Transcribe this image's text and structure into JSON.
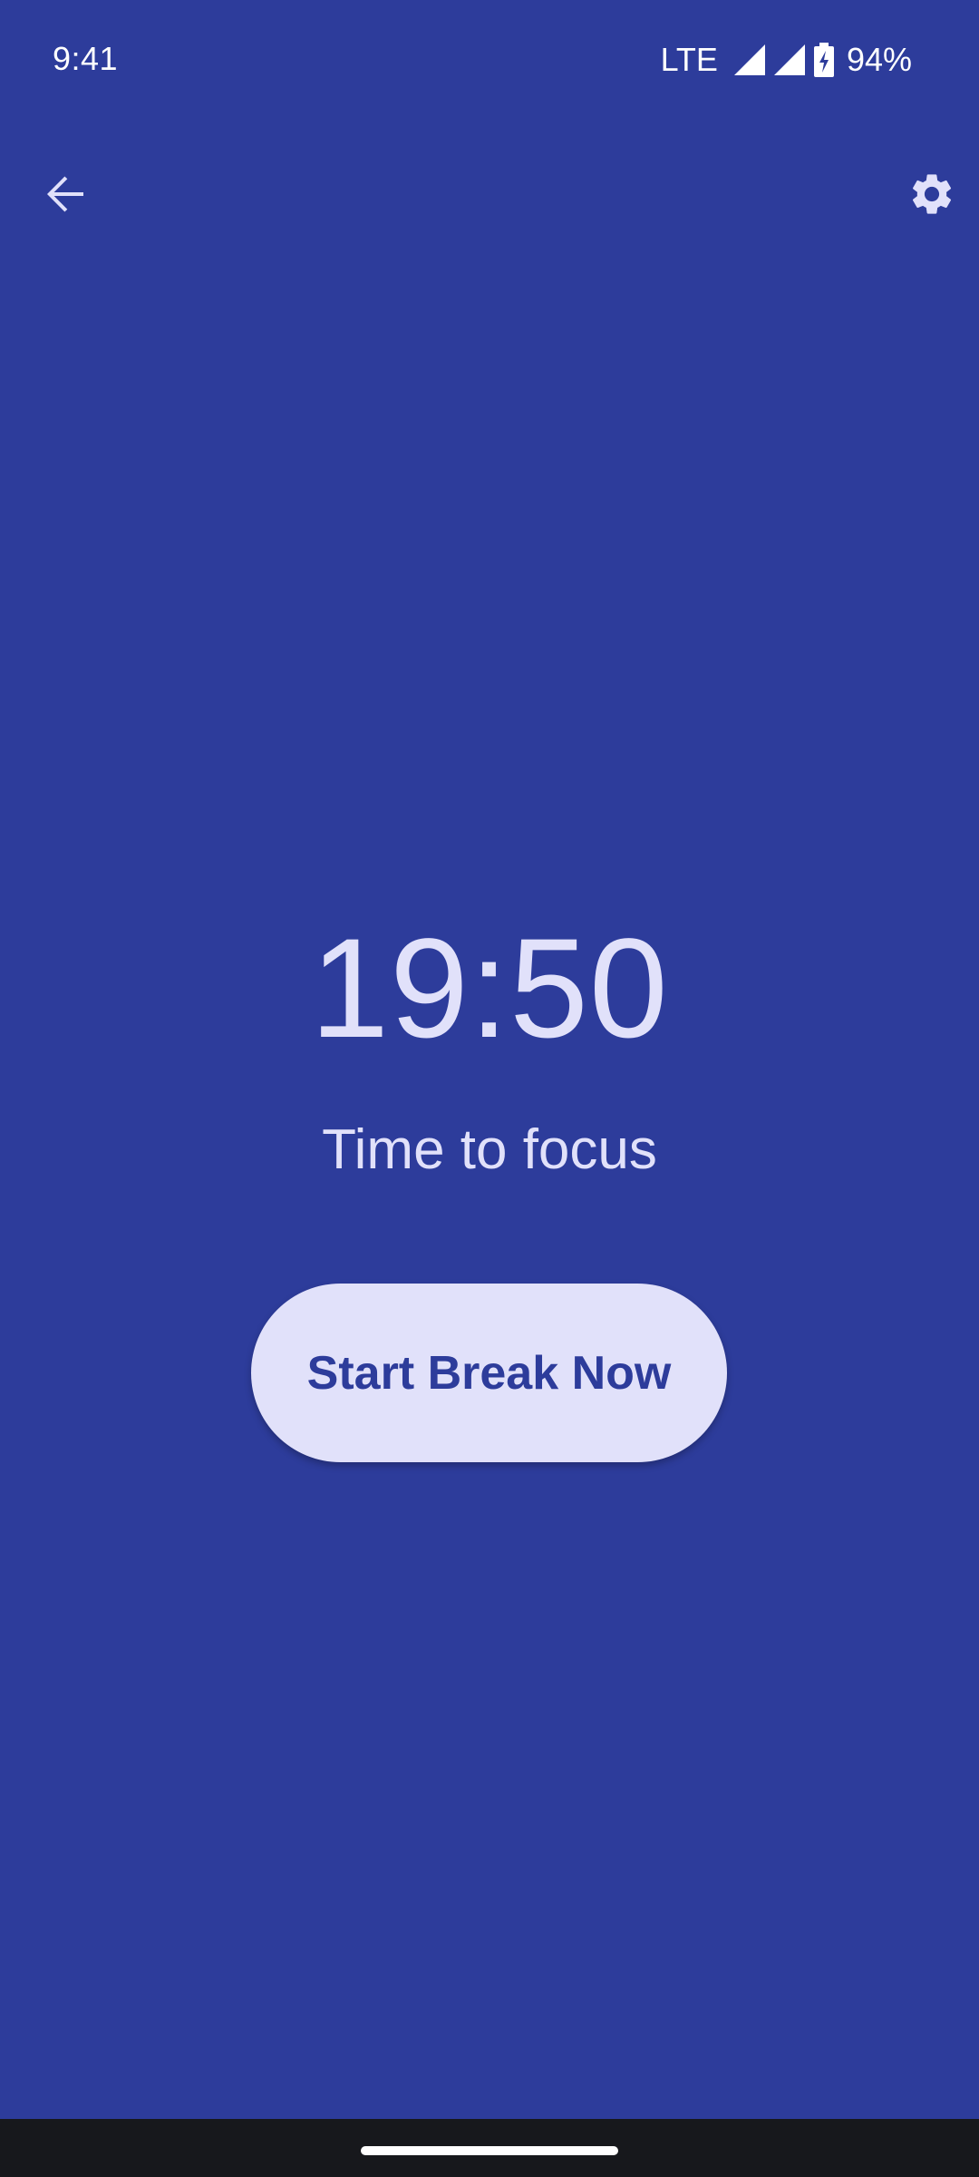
{
  "status_bar": {
    "time": "9:41",
    "network": "LTE",
    "battery_percent": "94%",
    "icons": [
      "signal-icon",
      "signal-icon",
      "battery-charging-icon"
    ]
  },
  "app_bar": {
    "back_icon": "arrow-back-icon",
    "settings_icon": "gear-icon"
  },
  "main": {
    "timer": "19:50",
    "subtitle": "Time to focus",
    "break_button_label": "Start Break Now"
  },
  "colors": {
    "background": "#2d3c9b",
    "text": "#e1e1fa",
    "button_bg": "#e1e1fa",
    "button_text": "#2d3c9b",
    "nav_bar": "#17181c"
  }
}
